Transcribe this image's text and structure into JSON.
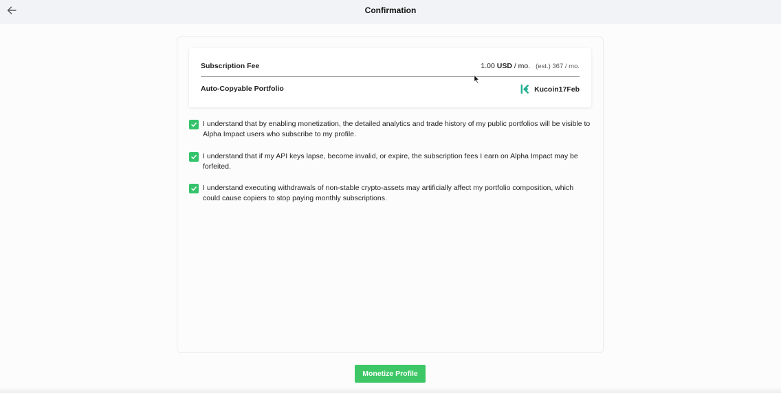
{
  "header": {
    "title": "Confirmation",
    "back_icon": "arrow-left-icon"
  },
  "summary": {
    "fee_label": "Subscription Fee",
    "fee_amount": "1.00",
    "fee_currency": "USD",
    "fee_period": "/ mo.",
    "fee_estimate": "(est.) 367 / mo.",
    "portfolio_label": "Auto-Copyable Portfolio",
    "portfolio_name": "Kucoin17Feb",
    "portfolio_icon": "kucoin-logo-icon"
  },
  "agreements": [
    {
      "checked": true,
      "text": "I understand that by enabling monetization, the detailed analytics and trade history of my public portfolios will be visible to Alpha Impact users who subscribe to my profile."
    },
    {
      "checked": true,
      "text": "I understand that if my API keys lapse, become invalid, or expire, the subscription fees I earn on Alpha Impact may be forfeited."
    },
    {
      "checked": true,
      "text": "I understand executing withdrawals of non-stable crypto-assets may artificially affect my portfolio composition, which could cause copiers to stop paying monthly subscriptions."
    }
  ],
  "cta": {
    "label": "Monetize Profile"
  },
  "colors": {
    "accent": "#3ec766",
    "checkbox": "#34c36b",
    "kucoin": "#23af91"
  }
}
